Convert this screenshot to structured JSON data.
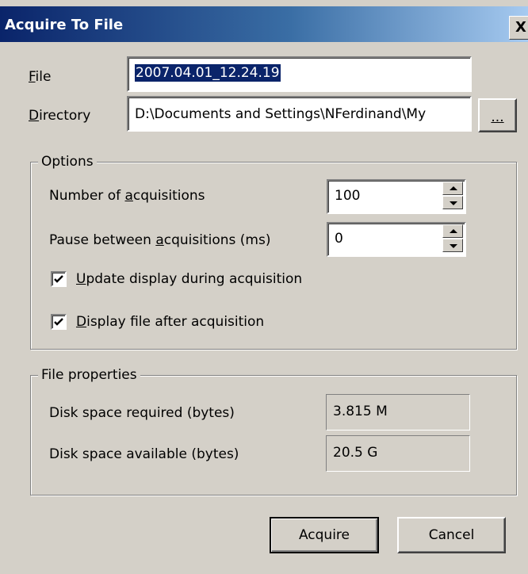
{
  "window": {
    "title": "Acquire To File",
    "close_glyph": "X"
  },
  "file": {
    "label_accel": "F",
    "label_rest": "ile",
    "value": "2007.04.01_12.24.19"
  },
  "directory": {
    "label_accel": "D",
    "label_rest": "irectory",
    "value": "D:\\Documents and Settings\\NFerdinand\\My",
    "browse_label": "..."
  },
  "options": {
    "legend": "Options",
    "acquisitions": {
      "label_pre": "Number of ",
      "label_accel": "a",
      "label_post": "cquisitions",
      "value": "100"
    },
    "pause": {
      "label_pre": "Pause between ",
      "label_accel": "a",
      "label_post": "cquisitions (ms)",
      "value": "0"
    },
    "update_display": {
      "label_accel": "U",
      "label_rest": "pdate display during acquisition",
      "checked": true
    },
    "display_file": {
      "label_accel": "D",
      "label_rest": "isplay file after acquisition",
      "checked": true
    }
  },
  "file_properties": {
    "legend": "File properties",
    "required_label": "Disk space required (bytes)",
    "required_value": "3.815 M",
    "available_label": "Disk space available (bytes)",
    "available_value": "20.5 G"
  },
  "buttons": {
    "acquire": "Acquire",
    "cancel": "Cancel"
  },
  "icons": {
    "close": "close-icon",
    "spin_up": "chevron-up-icon",
    "spin_down": "chevron-down-icon",
    "checkmark": "checkmark-icon"
  },
  "colors": {
    "face": "#d4d0c8",
    "title_start": "#0a246a",
    "title_end": "#a6caf0",
    "selection": "#0a246a"
  }
}
